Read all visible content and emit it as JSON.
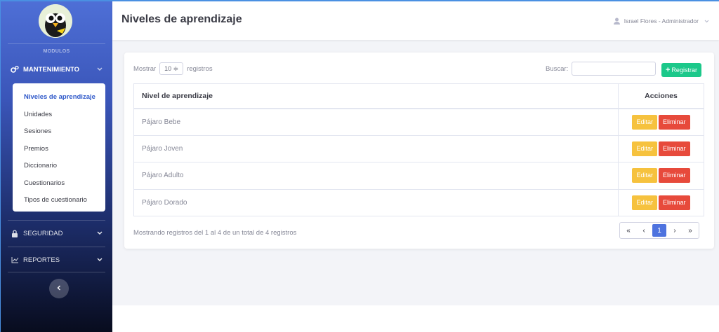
{
  "sidebar": {
    "modulos_label": "MODULOS",
    "sections": [
      {
        "label": "MANTENIMIENTO",
        "icon": "gears-icon",
        "active": true
      },
      {
        "label": "SEGURIDAD",
        "icon": "lock-icon",
        "active": false
      },
      {
        "label": "REPORTES",
        "icon": "chart-line-icon",
        "active": false
      }
    ],
    "submenu": [
      {
        "label": "Niveles de aprendizaje",
        "active": true
      },
      {
        "label": "Unidades"
      },
      {
        "label": "Sesiones"
      },
      {
        "label": "Premios"
      },
      {
        "label": "Diccionario"
      },
      {
        "label": "Cuestionarios"
      },
      {
        "label": "Tipos de cuestionario"
      }
    ]
  },
  "header": {
    "title": "Niveles de aprendizaje",
    "user": "Israel Flores - Administrador"
  },
  "table_controls": {
    "show_prefix": "Mostrar",
    "page_length": "10 ≑",
    "show_suffix": "registros",
    "search_label": "Buscar:",
    "search_value": "",
    "register_button": "Registrar"
  },
  "table": {
    "columns": [
      "Nivel de aprendizaje",
      "Acciones"
    ],
    "rows": [
      {
        "name": "Pájaro Bebe"
      },
      {
        "name": "Pájaro Joven"
      },
      {
        "name": "Pájaro Adulto"
      },
      {
        "name": "Pájaro Dorado"
      }
    ],
    "edit_label": "Editar",
    "delete_label": "Eliminar"
  },
  "footer": {
    "info": "Mostrando registros del 1 al 4 de un total de 4 registros",
    "pager": {
      "first": "«",
      "prev": "‹",
      "current": "1",
      "next": "›",
      "last": "»"
    }
  },
  "colors": {
    "primary": "#4e73df",
    "success": "#1cc88a",
    "warning": "#f6c23e",
    "danger": "#e74a3b"
  }
}
